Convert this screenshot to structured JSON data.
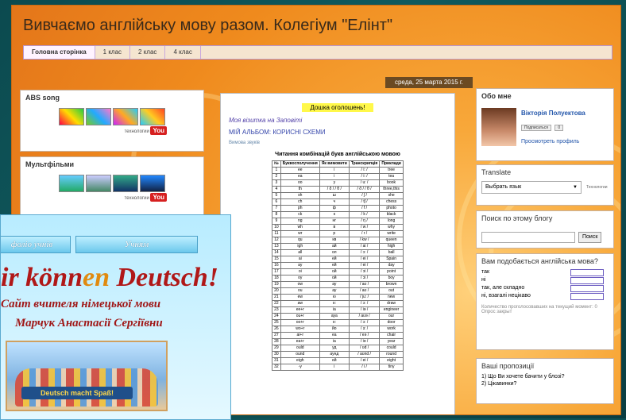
{
  "blog": {
    "title": "Вивчаємо англійську мову разом. Колегіум \"Елінт\"",
    "tabs": [
      {
        "label": "Головна сторінка",
        "active": true
      },
      {
        "label": "1 клас"
      },
      {
        "label": "2 клас"
      },
      {
        "label": "4 клас"
      }
    ],
    "date": "среда, 25 марта 2015 г."
  },
  "left": {
    "abc_title": "ABS song",
    "cartoons_title": "Мультфільми",
    "youtube_prefix": "технологии",
    "youtube": "You"
  },
  "center": {
    "notice": "Дошка оголошень!",
    "link1": "Моя візитка на Заповіті",
    "link2": "МІЙ АЛЬБОМ: КОРИСНІ СХЕМИ",
    "link3": "Вимова звуків",
    "table_title": "Читання комбінацій букв англійською мовою",
    "table_headers": [
      "№",
      "Буквосполучення",
      "Як вимовити",
      "Транскрипція",
      "Приклади"
    ],
    "table_rows": [
      [
        "1",
        "ee",
        "і",
        "/ і: /",
        "tree"
      ],
      [
        "2",
        "ea",
        "і",
        "/ і: /",
        "tea"
      ],
      [
        "3",
        "oo",
        "у",
        "/ u: /",
        "book"
      ],
      [
        "4",
        "th",
        "/ ð / / θ /",
        "/ ð / / θ /",
        "three,this"
      ],
      [
        "5",
        "sh",
        "ш",
        "/ ʃ /",
        "she"
      ],
      [
        "6",
        "ch",
        "ч",
        "/ tʃ /",
        "chess"
      ],
      [
        "7",
        "ph",
        "ф",
        "/ f /",
        "photo"
      ],
      [
        "8",
        "ck",
        "к",
        "/ k /",
        "black"
      ],
      [
        "9",
        "ng",
        "нг",
        "/ ŋ /",
        "long"
      ],
      [
        "10",
        "wh",
        "в",
        "/ w /",
        "why"
      ],
      [
        "11",
        "wr",
        "р",
        "/ r /",
        "write"
      ],
      [
        "12",
        "qu",
        "кв",
        "/ kw /",
        "queen"
      ],
      [
        "13",
        "igh",
        "ай",
        "/ ai /",
        "high"
      ],
      [
        "14",
        "all",
        "ол",
        "/ ɔ: /",
        "ball"
      ],
      [
        "15",
        "ai",
        "ей",
        "/ ei /",
        "Spain"
      ],
      [
        "16",
        "ay",
        "ей",
        "/ ei /",
        "day"
      ],
      [
        "17",
        "oi",
        "ой",
        "/ ɔi /",
        "point"
      ],
      [
        "18",
        "oy",
        "ой",
        "/ ɔi /",
        "boy"
      ],
      [
        "19",
        "ow",
        "ау",
        "/ aʊ /",
        "brown"
      ],
      [
        "20",
        "ou",
        "ау",
        "/ aʊ /",
        "out"
      ],
      [
        "21",
        "ew",
        "ю",
        "/ ju: /",
        "new"
      ],
      [
        "22",
        "aw",
        "о:",
        "/ ɔ: /",
        "draw"
      ],
      [
        "23",
        "ee+r",
        "іа",
        "/ iə /",
        "engineer"
      ],
      [
        "24",
        "ou+r",
        "ауа",
        "/ aʊə /",
        "our"
      ],
      [
        "25",
        "oo+r",
        "о:",
        "/ ɔ: /",
        "door"
      ],
      [
        "26",
        "wo+r",
        "йо",
        "/ ɜ: /",
        "work"
      ],
      [
        "27",
        "ai+r",
        "еа",
        "/ eə /",
        "chair"
      ],
      [
        "28",
        "ea+r",
        "іа",
        "/ iə /",
        "year"
      ],
      [
        "29",
        "ould",
        "уд",
        "/ ʊd /",
        "could"
      ],
      [
        "30",
        "ound",
        "аунд",
        "/ aʊnd /",
        "round"
      ],
      [
        "31",
        "eigh",
        "ей",
        "/ ei /",
        "eight"
      ],
      [
        "32",
        "-y",
        "і",
        "/ i /",
        "tiny"
      ]
    ]
  },
  "right": {
    "about_title": "Обо мне",
    "user_name": "Вікторія Полуектова",
    "subscribe": "Подписаться",
    "subscribe_count": "0",
    "profile_link": "Просмотреть профиль",
    "translate_title": "Translate",
    "lang_select": "Выбрать язык",
    "translate_by": "Технологии",
    "search_title": "Поиск по этому блогу",
    "search_btn": "Поиск",
    "poll_title": "Вам подобається англійська мова?",
    "poll_options": [
      "так",
      "ні",
      "так, але складно",
      "ні, взагалі нецікаво"
    ],
    "poll_votes": "Количество проголосовавших на текущий момент: 0",
    "poll_status": "Опрос закрыт",
    "suggest_title": "Ваші пропозиції",
    "suggest_q1": "1) Що Ви хочете бачити у блозі?",
    "suggest_q2": "2) Цікавинки?"
  },
  "overlay": {
    "btn_left": "фоліо учнів",
    "btn_right": "Учням",
    "headline_a": "ir könn",
    "headline_b": "en",
    "headline_c": " Deutsch!",
    "line1": "Сайт вчителя німецької мови",
    "line2": "Марчук Анастасії Сергіївни",
    "banner": "Deutsch macht Spaß!"
  }
}
